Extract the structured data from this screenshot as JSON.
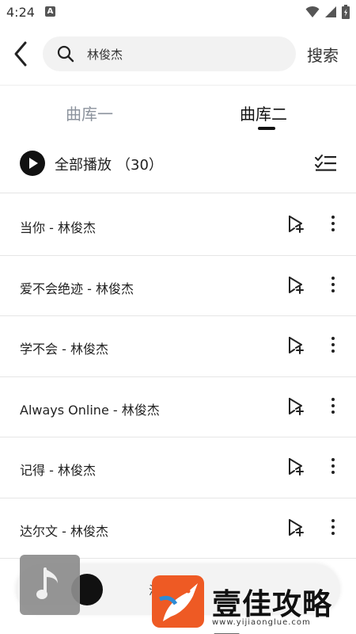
{
  "status_bar": {
    "time": "4:24",
    "notif_badge": "A"
  },
  "header": {
    "search_value": "林俊杰",
    "search_button": "搜索"
  },
  "tabs": [
    {
      "label": "曲库一",
      "active": false
    },
    {
      "label": "曲库二",
      "active": true
    }
  ],
  "play_all": {
    "label": "全部播放",
    "count": "（30）"
  },
  "songs": [
    {
      "title": "当你 - 林俊杰"
    },
    {
      "title": "爱不会绝迹 - 林俊杰"
    },
    {
      "title": "学不会 - 林俊杰"
    },
    {
      "title": "Always Online - 林俊杰"
    },
    {
      "title": "记得 - 林俊杰"
    },
    {
      "title": "达尔文 - 林俊杰"
    }
  ],
  "player": {
    "partial_text": "汽"
  },
  "watermark": {
    "text": "壹佳攻略网",
    "url": "www.yijiaonglue.com"
  },
  "colors": {
    "accent": "#111111",
    "inactive_tab": "#8b929c",
    "search_bg": "#f2f2f2",
    "logo": "#ee5a24"
  }
}
